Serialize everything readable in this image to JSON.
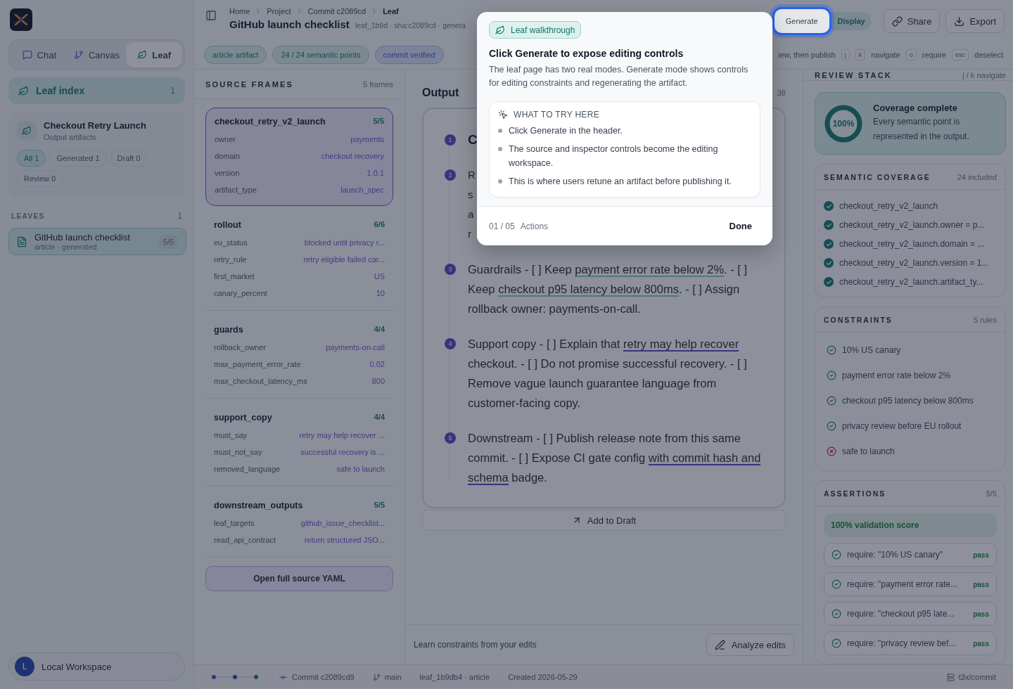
{
  "sidebar": {
    "nav_tabs": [
      {
        "label": "Chat",
        "selected": false
      },
      {
        "label": "Canvas",
        "selected": false
      },
      {
        "label": "Leaf",
        "selected": true
      }
    ],
    "leaf_index": {
      "label": "Leaf index",
      "count": "1"
    },
    "project": {
      "title": "Checkout Retry Launch",
      "subtitle": "Output artifacts",
      "filters": [
        {
          "label": "All 1",
          "selected": true
        },
        {
          "label": "Generated 1",
          "selected": false
        },
        {
          "label": "Draft 0",
          "selected": false
        },
        {
          "label": "Review 0",
          "selected": false
        }
      ]
    },
    "leaves": {
      "heading": "LEAVES",
      "count": "1",
      "items": [
        {
          "title": "GitHub launch checklist",
          "meta": "article · generated",
          "badge": "5/5",
          "selected": true
        }
      ]
    },
    "workspace": {
      "avatar": "L",
      "name": "Local Workspace"
    }
  },
  "header": {
    "breadcrumbs": [
      "Home",
      "Project",
      "Commit c2089cd",
      "Leaf"
    ],
    "title": "GitHub launch checklist",
    "meta": "leaf_1b9d · sha:c2089cd · genera",
    "mode_toggle": [
      {
        "label": "Generate",
        "selected": false
      },
      {
        "label": "Display",
        "selected": true
      }
    ],
    "actions": [
      {
        "kind": "share",
        "label": "Share"
      },
      {
        "kind": "export",
        "label": "Export"
      }
    ],
    "chips": [
      {
        "label": "article artifact",
        "kind": "info"
      },
      {
        "label": "24 / 24 semantic points",
        "kind": "info"
      },
      {
        "label": "commit verified",
        "kind": "verified"
      }
    ],
    "hint": "iew, then publish",
    "shortcuts": [
      {
        "keys": [
          "j",
          "k"
        ],
        "label": "navigate"
      },
      {
        "keys": [
          "o"
        ],
        "label": "require"
      },
      {
        "keys": [
          "esc"
        ],
        "label": "deselect"
      }
    ]
  },
  "source_frames": {
    "heading": "SOURCE FRAMES",
    "count": "5 frames",
    "frames": [
      {
        "name": "checkout_retry_v2_launch",
        "score": "5/5",
        "selected": true,
        "fields": [
          {
            "key": "owner",
            "value": "payments"
          },
          {
            "key": "domain",
            "value": "checkout recovery"
          },
          {
            "key": "version",
            "value": "1.0.1"
          },
          {
            "key": "artifact_type",
            "value": "launch_spec"
          }
        ]
      },
      {
        "name": "rollout",
        "score": "6/6",
        "selected": false,
        "fields": [
          {
            "key": "eu_status",
            "value": "blocked until privacy r..."
          },
          {
            "key": "retry_rule",
            "value": "retry eligible failed car..."
          },
          {
            "key": "first_market",
            "value": "US"
          },
          {
            "key": "canary_percent",
            "value": "10"
          }
        ]
      },
      {
        "name": "guards",
        "score": "4/4",
        "selected": false,
        "fields": [
          {
            "key": "rollback_owner",
            "value": "payments-on-call"
          },
          {
            "key": "max_payment_error_rate",
            "value": "0.02"
          },
          {
            "key": "max_checkout_latency_ms",
            "value": "800"
          }
        ]
      },
      {
        "name": "support_copy",
        "score": "4/4",
        "selected": false,
        "fields": [
          {
            "key": "must_say",
            "value": "retry may help recover ..."
          },
          {
            "key": "must_not_say",
            "value": "successful recovery is ..."
          },
          {
            "key": "removed_language",
            "value": "safe to launch"
          }
        ]
      },
      {
        "name": "downstream_outputs",
        "score": "5/5",
        "selected": false,
        "fields": [
          {
            "key": "leaf_targets",
            "value": "github_issue_checklist..."
          },
          {
            "key": "read_api_contract",
            "value": "return structured JSO..."
          }
        ]
      }
    ],
    "button": "Open full source YAML"
  },
  "output": {
    "title": "Output",
    "count": "38",
    "items": [
      {
        "number": "1",
        "kind": "heading",
        "text": "C"
      },
      {
        "number": "2",
        "kind": "lines",
        "lines": [
          "R",
          "s",
          "a",
          "r"
        ]
      },
      {
        "number": "3",
        "kind": "paragraph",
        "segments": [
          {
            "text": "Guardrails - [ ] Keep "
          },
          {
            "text": "payment error rate below 2%",
            "kind": "constraint"
          },
          {
            "text": ". - [ ] Keep "
          },
          {
            "text": "checkout p95 latency below 800ms",
            "kind": "constraint"
          },
          {
            "text": ". - [ ] Assign rollback owner: payments-on-call."
          }
        ]
      },
      {
        "number": "4",
        "kind": "paragraph",
        "segments": [
          {
            "text": "Support copy - [ ] Explain that "
          },
          {
            "text": "retry may help recover",
            "kind": "point"
          },
          {
            "text": " checkout. - [ ] Do not promise successful recovery. - [ ] Remove vague launch guarantee language from customer-facing copy."
          }
        ]
      },
      {
        "number": "5",
        "kind": "paragraph",
        "segments": [
          {
            "text": "Downstream - [ ] Publish release note from this same commit. - [ ] Expose CI gate config "
          },
          {
            "text": "with commit hash and schema",
            "kind": "point"
          },
          {
            "text": " badge."
          }
        ]
      }
    ],
    "add_button": "Add to Draft",
    "learn": {
      "text": "Learn constraints from your edits",
      "button": "Analyze edits"
    }
  },
  "review": {
    "heading": "REVIEW STACK",
    "hint": "j / k navigate",
    "coverage": {
      "value": "100%",
      "level": 1,
      "title": "Coverage complete",
      "text": "Every semantic point is represented in the output."
    },
    "semantic": {
      "heading": "SEMANTIC COVERAGE",
      "count": "24 included",
      "items": [
        "checkout_retry_v2_launch",
        "checkout_retry_v2_launch.owner = p...",
        "checkout_retry_v2_launch.domain = ...",
        "checkout_retry_v2_launch.version = 1...",
        "checkout_retry_v2_launch.artifact_ty..."
      ]
    },
    "constraints": {
      "heading": "CONSTRAINTS",
      "count": "5 rules",
      "items": [
        {
          "label": "10% US canary",
          "passed": true
        },
        {
          "label": "payment error rate below 2%",
          "passed": true
        },
        {
          "label": "checkout p95 latency below 800ms",
          "passed": true
        },
        {
          "label": "privacy review before EU rollout",
          "passed": true
        },
        {
          "label": "safe to launch",
          "passed": false
        }
      ]
    },
    "assertions": {
      "heading": "ASSERTIONS",
      "count": "5/5",
      "score": "100% validation score",
      "items": [
        {
          "label": "require: \"10% US canary\"",
          "result": "pass"
        },
        {
          "label": "require: \"payment error rate...",
          "result": "pass"
        },
        {
          "label": "require: \"checkout p95 late...",
          "result": "pass"
        },
        {
          "label": "require: \"privacy review bef...",
          "result": "pass"
        }
      ]
    }
  },
  "status_bar": {
    "commit": "Commit c2089cd9",
    "branch": "main",
    "leaf": "leaf_1b9db4 · article",
    "created": "Created 2026-05-29",
    "repo": "t3x/commit"
  },
  "walkthrough": {
    "badge": "Leaf walkthrough",
    "title": "Click Generate to expose editing controls",
    "body": "The leaf page has two real modes. Generate mode shows controls for editing constraints and regenerating the artifact.",
    "section": "WHAT TO TRY HERE",
    "bullets": [
      "Click Generate in the header.",
      "The source and inspector controls become the editing workspace.",
      "This is where users retune an artifact before publishing it."
    ],
    "step": "01 / 05",
    "step_label": "Actions",
    "done": "Done"
  }
}
